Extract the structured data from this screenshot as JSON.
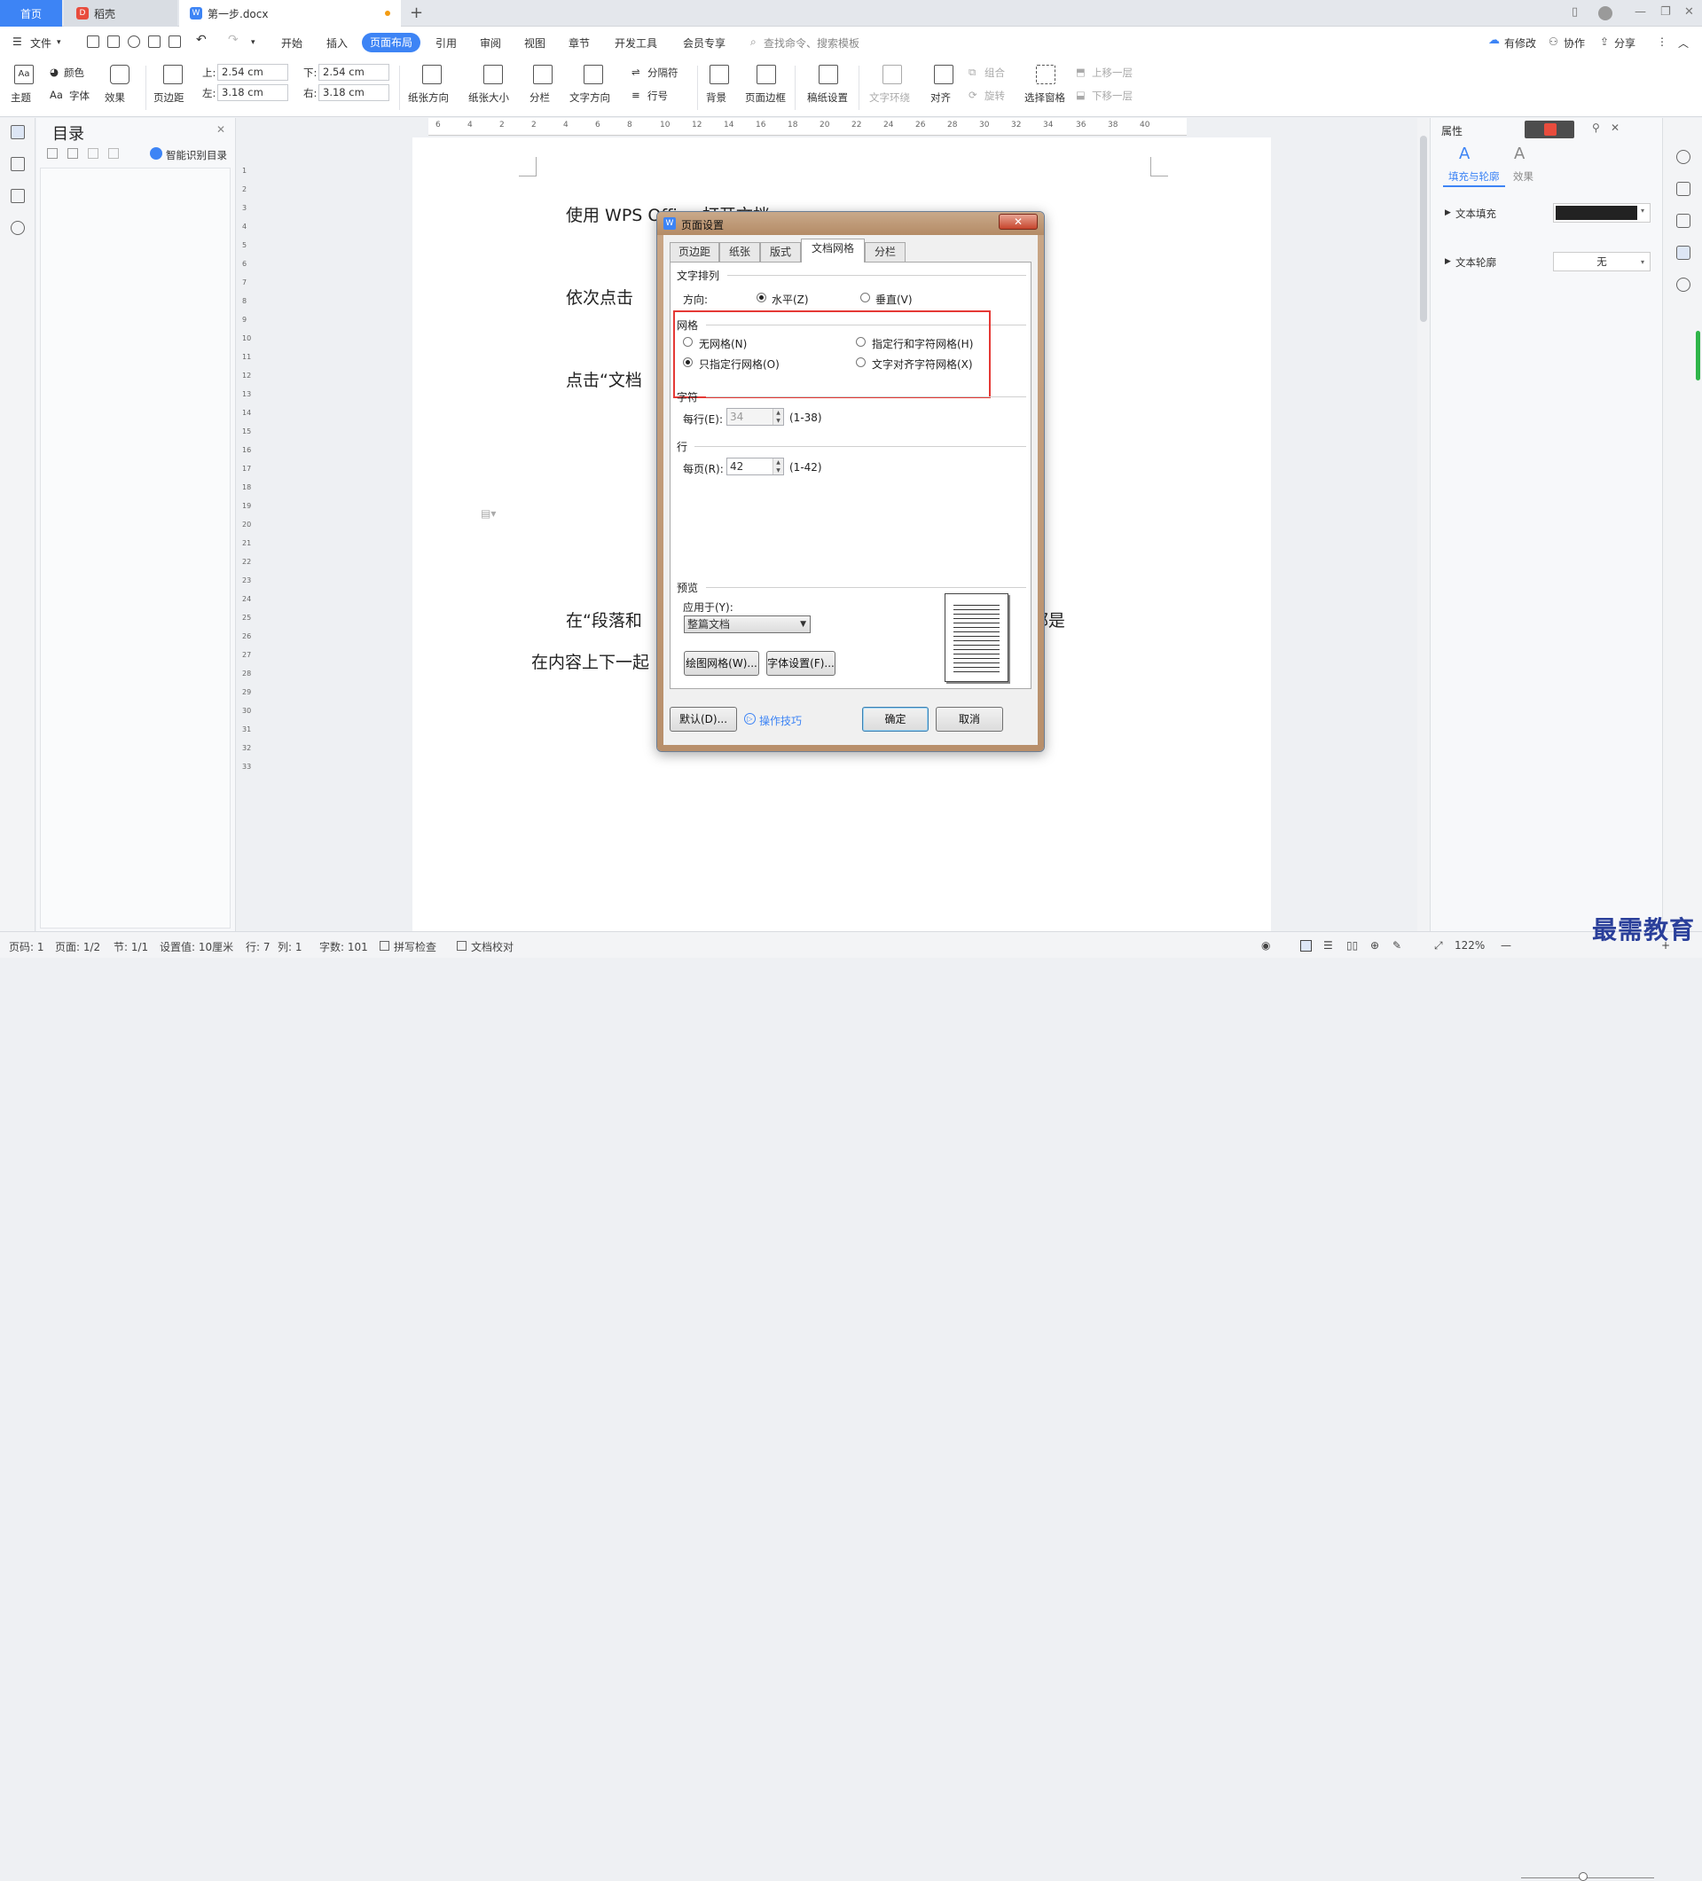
{
  "tabs": {
    "home": "首页",
    "store": "稻壳",
    "doc": "第一步.docx"
  },
  "menu": {
    "file": "文件",
    "items": [
      "开始",
      "插入",
      "页面布局",
      "引用",
      "审阅",
      "视图",
      "章节",
      "开发工具",
      "会员专享"
    ],
    "active": "页面布局",
    "search": "查找命令、搜索模板",
    "right": [
      "有修改",
      "协作",
      "分享"
    ]
  },
  "ribbon": {
    "theme": "主题",
    "colors": "颜色",
    "font": "字体",
    "effects": "效果",
    "margins": "页边距",
    "top_label": "上:",
    "top_val": "2.54 cm",
    "bottom_label": "下:",
    "bottom_val": "2.54 cm",
    "left_label": "左:",
    "left_val": "3.18 cm",
    "right_label": "右:",
    "right_val": "3.18 cm",
    "orientation": "纸张方向",
    "size": "纸张大小",
    "columns": "分栏",
    "text_dir": "文字方向",
    "breaks": "分隔符",
    "line_num": "行号",
    "background": "背景",
    "border": "页面边框",
    "manuscript": "稿纸设置",
    "wrap": "文字环绕",
    "align": "对齐",
    "group": "组合",
    "rotate": "旋转",
    "select_pane": "选择窗格",
    "bring_fwd": "上移一层",
    "send_back": "下移一层"
  },
  "toc": {
    "title": "目录",
    "smart": "智能识别目录"
  },
  "ruler_h": [
    "6",
    "4",
    "2",
    "2",
    "4",
    "6",
    "8",
    "10",
    "12",
    "14",
    "16",
    "18",
    "20",
    "22",
    "24",
    "26",
    "28",
    "30",
    "32",
    "34",
    "36",
    "38",
    "40"
  ],
  "ruler_v": [
    "1",
    "2",
    "3",
    "4",
    "5",
    "6",
    "7",
    "8",
    "9",
    "10",
    "11",
    "12",
    "13",
    "14",
    "15",
    "16",
    "17",
    "18",
    "19",
    "20",
    "21",
    "22",
    "23",
    "24",
    "25",
    "26",
    "27",
    "28",
    "29",
    "30",
    "31",
    "32",
    "33"
  ],
  "document": {
    "line1": "使用 WPS Office 打开文档。",
    "line2": "依次点击",
    "line3": "点击“文档",
    "line4a": "在“段落和",
    "line4b": "齐”行距都是",
    "line5": "在内容上下一起"
  },
  "dialog": {
    "title": "页面设置",
    "tabs": [
      "页边距",
      "纸张",
      "版式",
      "文档网格",
      "分栏"
    ],
    "active_tab": "文档网格",
    "text_arrange": "文字排列",
    "direction": "方向:",
    "horizontal": "水平(Z)",
    "vertical": "垂直(V)",
    "grid": "网格",
    "no_grid": "无网格(N)",
    "line_char_grid": "指定行和字符网格(H)",
    "line_grid_only": "只指定行网格(O)",
    "char_align_grid": "文字对齐字符网格(X)",
    "chars": "字符",
    "per_line": "每行(E):",
    "per_line_val": "34",
    "per_line_range": "(1-38)",
    "lines": "行",
    "per_page": "每页(R):",
    "per_page_val": "42",
    "per_page_range": "(1-42)",
    "preview": "预览",
    "apply_to": "应用于(Y):",
    "apply_val": "整篇文档",
    "draw_grid": "绘图网格(W)...",
    "font_settings": "字体设置(F)...",
    "default": "默认(D)...",
    "tips": "操作技巧",
    "ok": "确定",
    "cancel": "取消"
  },
  "rpanel": {
    "title": "属性",
    "tab1": "填充与轮廓",
    "tab2": "效果",
    "fill": "文本填充",
    "outline": "文本轮廓",
    "outline_val": "无"
  },
  "status": {
    "page": "页码: 1",
    "pages": "页面: 1/2",
    "section": "节: 1/1",
    "setting": "设置值: 10厘米",
    "row": "行: 7",
    "col": "列: 1",
    "words": "字数: 101",
    "spell": "拼写检查",
    "proof": "文档校对",
    "zoom": "122%"
  },
  "watermark": "最需教育",
  "colors": {
    "accent": "#3d84f5",
    "highlight_box": "#e53935",
    "dialog_frame": "#b88f6b"
  }
}
